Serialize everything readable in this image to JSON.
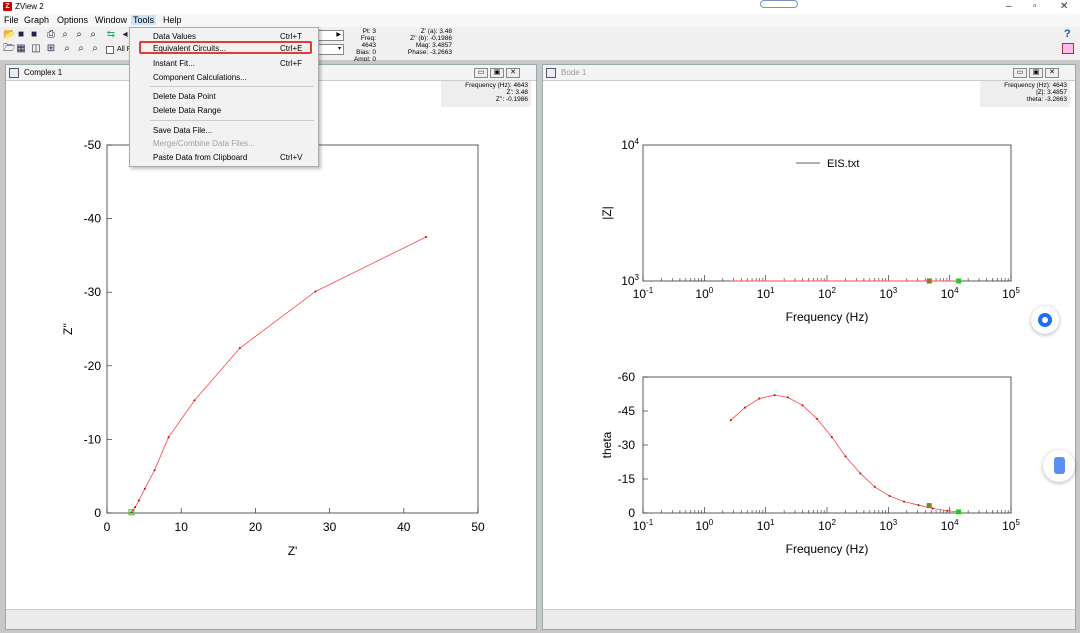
{
  "window": {
    "title": "ZView 2"
  },
  "menubar": {
    "items": [
      "File",
      "Graph",
      "Options",
      "Window",
      "Tools",
      "Help"
    ]
  },
  "toolbar": {
    "allf_label": "All F",
    "status": {
      "pt": "Pt: 3",
      "freq": "Freq: 4643",
      "bias": "Bias: 0",
      "ampl": "Ampl: 0",
      "za": "Z' (a): 3.48",
      "zb": "Z'' (b): -0.1986",
      "mag": "Mag: 3.4857",
      "phase": "Phase: -3.2663"
    },
    "help_icon": "?"
  },
  "tools_menu": {
    "items": [
      {
        "label": "Data Values",
        "shortcut": "Ctrl+T",
        "disabled": false
      },
      {
        "label": "Equivalent Circuits...",
        "shortcut": "Ctrl+E",
        "disabled": false,
        "highlighted": true
      },
      {
        "label": "Instant Fit...",
        "shortcut": "Ctrl+F",
        "disabled": false
      },
      {
        "label": "Component Calculations...",
        "shortcut": "",
        "disabled": false
      },
      {
        "label": "Delete Data Point",
        "shortcut": "",
        "disabled": false
      },
      {
        "label": "Delete Data Range",
        "shortcut": "",
        "disabled": false
      },
      {
        "label": "Save Data File...",
        "shortcut": "",
        "disabled": false
      },
      {
        "label": "Merge/Combine Data Files...",
        "shortcut": "",
        "disabled": true
      },
      {
        "label": "Paste Data from Clipboard",
        "shortcut": "Ctrl+V",
        "disabled": false
      }
    ]
  },
  "complex_window": {
    "title": "Complex 1",
    "info": {
      "freq": "Frequency (Hz): 4643",
      "zp": "Z': 3.48",
      "zpp": "Z'': -0.1986"
    }
  },
  "bode_window": {
    "title": "Bode 1",
    "info": {
      "freq": "Frequency (Hz): 4643",
      "mag": "|Z|: 3.4857",
      "theta": "theta: -3.2663"
    }
  },
  "colors": {
    "curve": "#ff4444",
    "point": "#cc0000",
    "marker_green": "#22cc22",
    "marker_olive": "#8a7a2a",
    "highlight_box": "#e53935"
  },
  "chart_data": [
    {
      "type": "line",
      "title": "",
      "xlabel": "Z'",
      "ylabel": "Z''",
      "xlim": [
        0,
        50
      ],
      "ylim": [
        0,
        -50
      ],
      "xticks": [
        "0",
        "10",
        "20",
        "30",
        "40",
        "50"
      ],
      "yticks": [
        "0",
        "-10",
        "-20",
        "-30",
        "-40",
        "-50"
      ],
      "series": [
        {
          "x": [
            3.3,
            3.5,
            3.8,
            4.3,
            5.1,
            6.4,
            8.3,
            11.8,
            17.9,
            28.1,
            43.0
          ],
          "y": [
            -0.1,
            -0.4,
            -0.8,
            -1.7,
            -3.3,
            -5.8,
            -10.3,
            -15.3,
            -22.4,
            -30.1,
            -37.5
          ]
        }
      ]
    },
    {
      "type": "line",
      "title": "",
      "xlabel": "Frequency (Hz)",
      "ylabel": "|Z|",
      "xscale": "log",
      "yscale": "log",
      "xlim": [
        0.1,
        100000
      ],
      "ylim": [
        1000,
        10000
      ],
      "legend": [
        "EIS.txt"
      ],
      "series": [
        {
          "name": "EIS.txt",
          "x": [
            2.7,
            14000
          ],
          "y": [
            1000,
            1000
          ]
        }
      ]
    },
    {
      "type": "line",
      "title": "",
      "xlabel": "Frequency (Hz)",
      "ylabel": "theta",
      "xscale": "log",
      "xlim": [
        0.1,
        100000
      ],
      "ylim": [
        0,
        -60
      ],
      "yticks": [
        "0",
        "-15",
        "-30",
        "-45",
        "-60"
      ],
      "series": [
        {
          "x": [
            2.7,
            4.6,
            7.9,
            14,
            23,
            40,
            69,
            120,
            200,
            350,
            600,
            1050,
            1800,
            3100,
            5300,
            9200,
            14000
          ],
          "y": [
            -41,
            -46.5,
            -50.5,
            -52,
            -51,
            -47.5,
            -41.5,
            -33.5,
            -25,
            -17.5,
            -11.5,
            -7.5,
            -5,
            -3.5,
            -2,
            -1,
            -0.5
          ]
        }
      ]
    }
  ]
}
